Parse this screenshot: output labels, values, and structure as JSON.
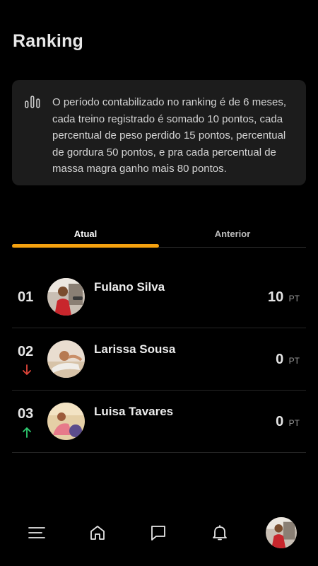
{
  "header": {
    "title": "Ranking"
  },
  "info": {
    "icon": "bar-chart-icon",
    "text": "O período contabilizado no ranking é de 6 meses, cada treino registrado é somado 10 pontos, cada percentual de peso perdido 15 pontos, percentual de gordura 50 pontos, e pra cada percentual de massa magra ganho mais 80 pontos."
  },
  "tabs": {
    "active": "Atual",
    "inactive": "Anterior",
    "accent_color": "#f5a10f"
  },
  "ranking": [
    {
      "position": "01",
      "name": "Fulano Silva",
      "points": "10",
      "unit": "PT",
      "trend": "none"
    },
    {
      "position": "02",
      "name": "Larissa Sousa",
      "points": "0",
      "unit": "PT",
      "trend": "down",
      "trend_color": "#e0453a"
    },
    {
      "position": "03",
      "name": "Luisa Tavares",
      "points": "0",
      "unit": "PT",
      "trend": "up",
      "trend_color": "#2ecc71"
    }
  ],
  "nav": {
    "items": [
      "menu-icon",
      "home-icon",
      "chat-icon",
      "bell-icon",
      "profile-avatar"
    ]
  }
}
